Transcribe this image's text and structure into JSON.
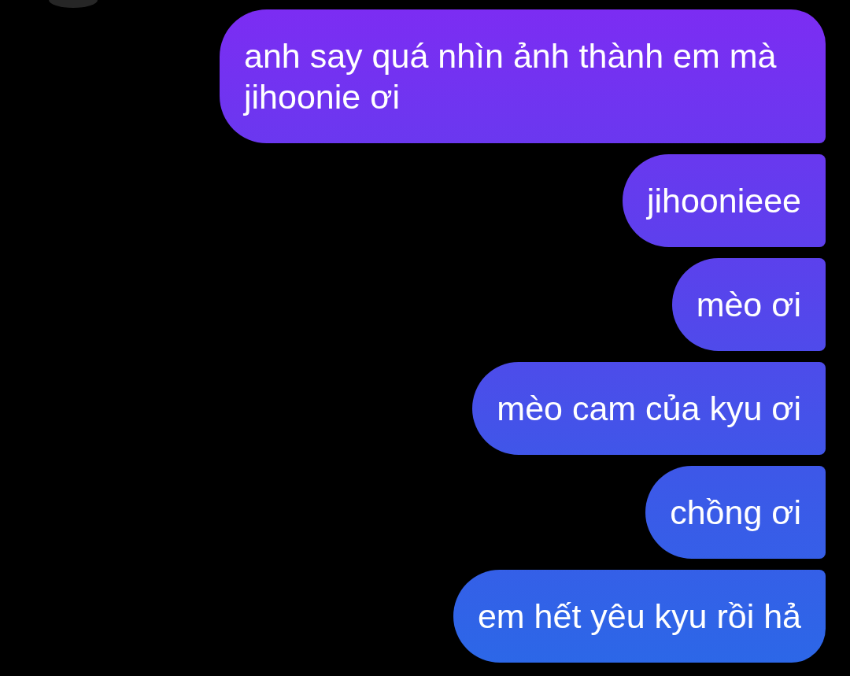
{
  "messages": [
    {
      "text": "anh say quá nhìn ảnh thành em mà jihoonie ơi"
    },
    {
      "text": "jihoonieee"
    },
    {
      "text": "mèo ơi"
    },
    {
      "text": "mèo cam của kyu ơi"
    },
    {
      "text": "chồng ơi"
    },
    {
      "text": "em hết yêu kyu rồi hả"
    }
  ]
}
